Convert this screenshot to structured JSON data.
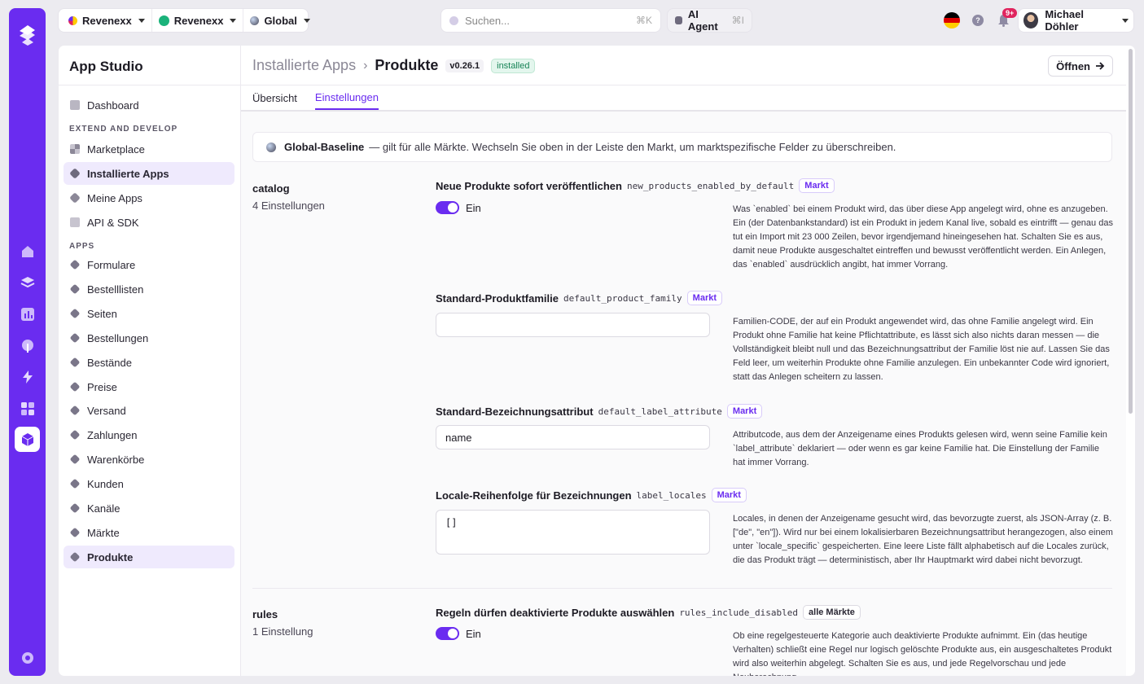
{
  "context": {
    "org": "Revenexx",
    "shop": "Revenexx",
    "market": "Global"
  },
  "search": {
    "placeholder": "Suchen...",
    "shortcut": "⌘K"
  },
  "agent": {
    "label": "AI Agent",
    "shortcut": "⌘I"
  },
  "notifications": {
    "badge": "9+"
  },
  "user": {
    "name": "Michael Döhler"
  },
  "sidebar": {
    "title": "App Studio",
    "dashboard": "Dashboard",
    "section_extend": "EXTEND AND DEVELOP",
    "extend_items": [
      "Marketplace",
      "Installierte Apps",
      "Meine Apps",
      "API & SDK"
    ],
    "section_apps": "APPS",
    "app_items": [
      "Formulare",
      "Bestelllisten",
      "Seiten",
      "Bestellungen",
      "Bestände",
      "Preise",
      "Versand",
      "Zahlungen",
      "Warenkörbe",
      "Kunden",
      "Kanäle",
      "Märkte",
      "Produkte"
    ]
  },
  "header": {
    "parent": "Installierte Apps",
    "separator": "›",
    "current": "Produkte",
    "version": "v0.26.1",
    "status": "installed",
    "open_label": "Öffnen"
  },
  "tabs": [
    "Übersicht",
    "Einstellungen"
  ],
  "banner": {
    "title": "Global-Baseline",
    "text": "— gilt für alle Märkte. Wechseln Sie oben in der Leiste den Markt, um marktspezifische Felder zu überschreiben."
  },
  "groups": [
    {
      "name": "catalog",
      "count": "4 Einstellungen"
    },
    {
      "name": "rules",
      "count": "1 Einstellung"
    }
  ],
  "settings": [
    {
      "label": "Neue Produkte sofort veröffentlichen",
      "key": "new_products_enabled_by_default",
      "scope": "Markt",
      "value": "Ein",
      "desc": "Was `enabled` bei einem Produkt wird, das über diese App angelegt wird, ohne es anzugeben. Ein (der Datenbankstandard) ist ein Produkt in jedem Kanal live, sobald es eintrifft — genau das tut ein Import mit 23 000 Zeilen, bevor irgendjemand hineingesehen hat. Schalten Sie es aus, damit neue Produkte ausgeschaltet eintreffen und bewusst veröffentlicht werden. Ein Anlegen, das `enabled` ausdrücklich angibt, hat immer Vorrang."
    },
    {
      "label": "Standard-Produktfamilie",
      "key": "default_product_family",
      "scope": "Markt",
      "value": "",
      "desc": "Familien-CODE, der auf ein Produkt angewendet wird, das ohne Familie angelegt wird. Ein Produkt ohne Familie hat keine Pflichtattribute, es lässt sich also nichts daran messen — die Vollständigkeit bleibt null und das Bezeichnungsattribut der Familie löst nie auf. Lassen Sie das Feld leer, um weiterhin Produkte ohne Familie anzulegen. Ein unbekannter Code wird ignoriert, statt das Anlegen scheitern zu lassen."
    },
    {
      "label": "Standard-Bezeichnungsattribut",
      "key": "default_label_attribute",
      "scope": "Markt",
      "value": "name",
      "desc": "Attributcode, aus dem der Anzeigename eines Produkts gelesen wird, wenn seine Familie kein `label_attribute` deklariert — oder wenn es gar keine Familie hat. Die Einstellung der Familie hat immer Vorrang."
    },
    {
      "label": "Locale-Reihenfolge für Bezeichnungen",
      "key": "label_locales",
      "scope": "Markt",
      "value": "[]",
      "desc": "Locales, in denen der Anzeigename gesucht wird, das bevorzugte zuerst, als JSON-Array (z. B. [\"de\", \"en\"]). Wird nur bei einem lokalisierbaren Bezeichnungsattribut herangezogen, also einem unter `locale_specific` gespeicherten. Eine leere Liste fällt alphabetisch auf die Locales zurück, die das Produkt trägt — deterministisch, aber Ihr Hauptmarkt wird dabei nicht bevorzugt."
    },
    {
      "label": "Regeln dürfen deaktivierte Produkte auswählen",
      "key": "rules_include_disabled",
      "scope": "alle Märkte",
      "value": "Ein",
      "desc": "Ob eine regelgesteuerte Kategorie auch deaktivierte Produkte aufnimmt. Ein (das heutige Verhalten) schließt eine Regel nur logisch gelöschte Produkte aus, ein ausgeschaltetes Produkt wird also weiterhin abgelegt. Schalten Sie es aus, und jede Regelvorschau und jede Neuberechnung"
    }
  ],
  "colors": {
    "accent": "#6a2cf0",
    "installed": "#188357"
  }
}
